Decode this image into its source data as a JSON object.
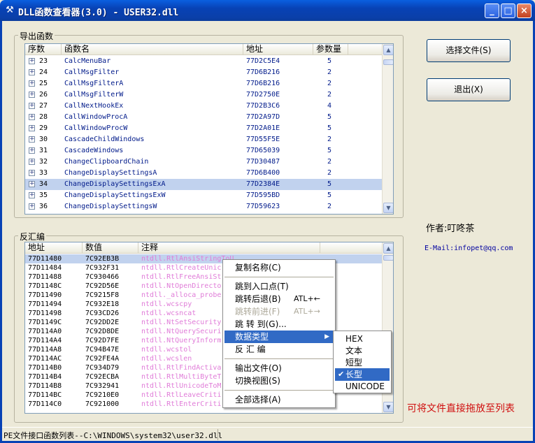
{
  "window": {
    "title": "DLL函数查看器(3.0) - USER32.dll",
    "app_icon": "tool-icon",
    "min_glyph": "_",
    "max_glyph": "□",
    "close_glyph": "×"
  },
  "export_group": {
    "label": "导出函数",
    "headers": [
      "序数",
      "函数名",
      "地址",
      "参数量"
    ],
    "rows": [
      {
        "ord": "23",
        "name": "CalcMenuBar",
        "addr": "77D2C5E4",
        "params": "5"
      },
      {
        "ord": "24",
        "name": "CallMsgFilter",
        "addr": "77D6B216",
        "params": "2"
      },
      {
        "ord": "25",
        "name": "CallMsgFilterA",
        "addr": "77D6B216",
        "params": "2"
      },
      {
        "ord": "26",
        "name": "CallMsgFilterW",
        "addr": "77D2750E",
        "params": "2"
      },
      {
        "ord": "27",
        "name": "CallNextHookEx",
        "addr": "77D2B3C6",
        "params": "4"
      },
      {
        "ord": "28",
        "name": "CallWindowProcA",
        "addr": "77D2A97D",
        "params": "5"
      },
      {
        "ord": "29",
        "name": "CallWindowProcW",
        "addr": "77D2A01E",
        "params": "5"
      },
      {
        "ord": "30",
        "name": "CascadeChildWindows",
        "addr": "77D55F5E",
        "params": "2"
      },
      {
        "ord": "31",
        "name": "CascadeWindows",
        "addr": "77D65039",
        "params": "5"
      },
      {
        "ord": "32",
        "name": "ChangeClipboardChain",
        "addr": "77D30487",
        "params": "2"
      },
      {
        "ord": "33",
        "name": "ChangeDisplaySettingsA",
        "addr": "77D6B400",
        "params": "2"
      },
      {
        "ord": "34",
        "name": "ChangeDisplaySettingsExA",
        "addr": "77D2384E",
        "params": "5"
      },
      {
        "ord": "35",
        "name": "ChangeDisplaySettingsExW",
        "addr": "77D595BD",
        "params": "5"
      },
      {
        "ord": "36",
        "name": "ChangeDisplaySettingsW",
        "addr": "77D59623",
        "params": "2"
      }
    ]
  },
  "disasm_group": {
    "label": "反汇编",
    "headers": [
      "地址",
      "数值",
      "注释"
    ],
    "rows": [
      {
        "addr": "77D11480",
        "val": "7C92EB3B",
        "comment": "ntdll.RtlAnsiStringToU"
      },
      {
        "addr": "77D11484",
        "val": "7C932F31",
        "comment": "ntdll.RtlCreateUnic"
      },
      {
        "addr": "77D11488",
        "val": "7C930466",
        "comment": "ntdll.RtlFreeAnsiSt"
      },
      {
        "addr": "77D1148C",
        "val": "7C92D56E",
        "comment": "ntdll.NtOpenDirecto"
      },
      {
        "addr": "77D11490",
        "val": "7C9215F8",
        "comment": "ntdll._alloca_probe"
      },
      {
        "addr": "77D11494",
        "val": "7C932E18",
        "comment": "ntdll.wcscpy"
      },
      {
        "addr": "77D11498",
        "val": "7C93CD26",
        "comment": "ntdll.wcsncat"
      },
      {
        "addr": "77D1149C",
        "val": "7C92DD2E",
        "comment": "ntdll.NtSetSecurity"
      },
      {
        "addr": "77D114A0",
        "val": "7C92D8DE",
        "comment": "ntdll.NtQuerySecuri"
      },
      {
        "addr": "77D114A4",
        "val": "7C92D7FE",
        "comment": "ntdll.NtQueryInform"
      },
      {
        "addr": "77D114A8",
        "val": "7C94B47E",
        "comment": "ntdll.wcstol"
      },
      {
        "addr": "77D114AC",
        "val": "7C92FE4A",
        "comment": "ntdll.wcslen"
      },
      {
        "addr": "77D114B0",
        "val": "7C934D79",
        "comment": "ntdll.RtlFindActiva"
      },
      {
        "addr": "77D114B4",
        "val": "7C92ECBA",
        "comment": "ntdll.RtlMultiByteT"
      },
      {
        "addr": "77D114B8",
        "val": "7C932941",
        "comment": "ntdll.RtlUnicodeToM"
      },
      {
        "addr": "77D114BC",
        "val": "7C9210E0",
        "comment": "ntdll.RtlLeaveCriti"
      },
      {
        "addr": "77D114C0",
        "val": "7C921000",
        "comment": "ntdll.RtlEnterCriti"
      }
    ]
  },
  "buttons": {
    "select_file": "选择文件(S)",
    "exit": "退出(X)"
  },
  "author": "作者:叮咚茶",
  "email": "E-Mail:infopet@qq.com",
  "hint": "可将文件直接拖放至列表",
  "status": "PE文件接口函数列表--C:\\WINDOWS\\system32\\user32.dll",
  "context_menu": {
    "items": [
      {
        "label": "复制名称(C)",
        "shortcut": "",
        "disabled": false
      },
      {
        "label": "跳到入口点(T)",
        "shortcut": "",
        "disabled": false
      },
      {
        "label": "跳转后退(B)",
        "shortcut": "ATL+←",
        "disabled": false
      },
      {
        "label": "跳转前进(F)",
        "shortcut": "ATL+→",
        "disabled": true
      },
      {
        "label": "跳 转 到(G)...",
        "shortcut": "",
        "disabled": false
      },
      {
        "label": "数据类型",
        "shortcut": "",
        "disabled": false
      },
      {
        "label": "反 汇 编",
        "shortcut": "",
        "disabled": false
      },
      {
        "label": "输出文件(O)",
        "shortcut": "",
        "disabled": false
      },
      {
        "label": "切换视图(S)",
        "shortcut": "",
        "disabled": false
      },
      {
        "label": "全部选择(A)",
        "shortcut": "",
        "disabled": false
      }
    ]
  },
  "submenu": {
    "items": [
      "HEX",
      "文本",
      "短型",
      "长型",
      "UNICODE"
    ],
    "checked": "长型"
  },
  "colors": {
    "selection_row": "#c1d2ee",
    "menu_highlight": "#316ac5",
    "comment_text": "#e07cd8",
    "hint_text": "#d01010"
  }
}
